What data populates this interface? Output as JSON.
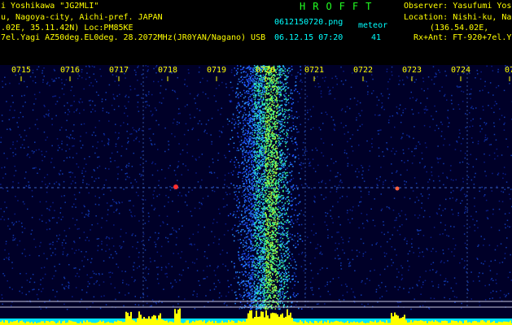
{
  "header": {
    "left_line1": "i Yoshikawa \"JG2MLI\"",
    "left_line2": "u, Nagoya-city, Aichi-pref. JAPAN",
    "left_line3": ".02E, 35.11.42N) Loc:PM85KE",
    "left_line4": "7el.Yagi AZ50deg.EL0deg. 28.2072MHz(JR0YAN/Nagano) USB",
    "title": "HROFFT",
    "filename": "0612150720.png",
    "mode_label": "meteor",
    "datetime": "06.12.15 07:20",
    "count": "41",
    "right_line1": "Observer: Yasufumi Yos",
    "right_line2": "Location: Nishi-ku, Na",
    "right_line3": "(136.54.02E,",
    "right_line4": "Rx+Ant: FT-920+7el.Y"
  },
  "time_ticks": [
    "0715",
    "0716",
    "0717",
    "0718",
    "0719",
    "0720",
    "0721",
    "0722",
    "0723",
    "0724",
    "07"
  ],
  "colors": {
    "background": "#000028",
    "header_text": "#ffff00",
    "info_text": "#00ffff",
    "title_text": "#22ff22",
    "trace": "#ffff00",
    "noise_floor": "#00e5ff"
  }
}
